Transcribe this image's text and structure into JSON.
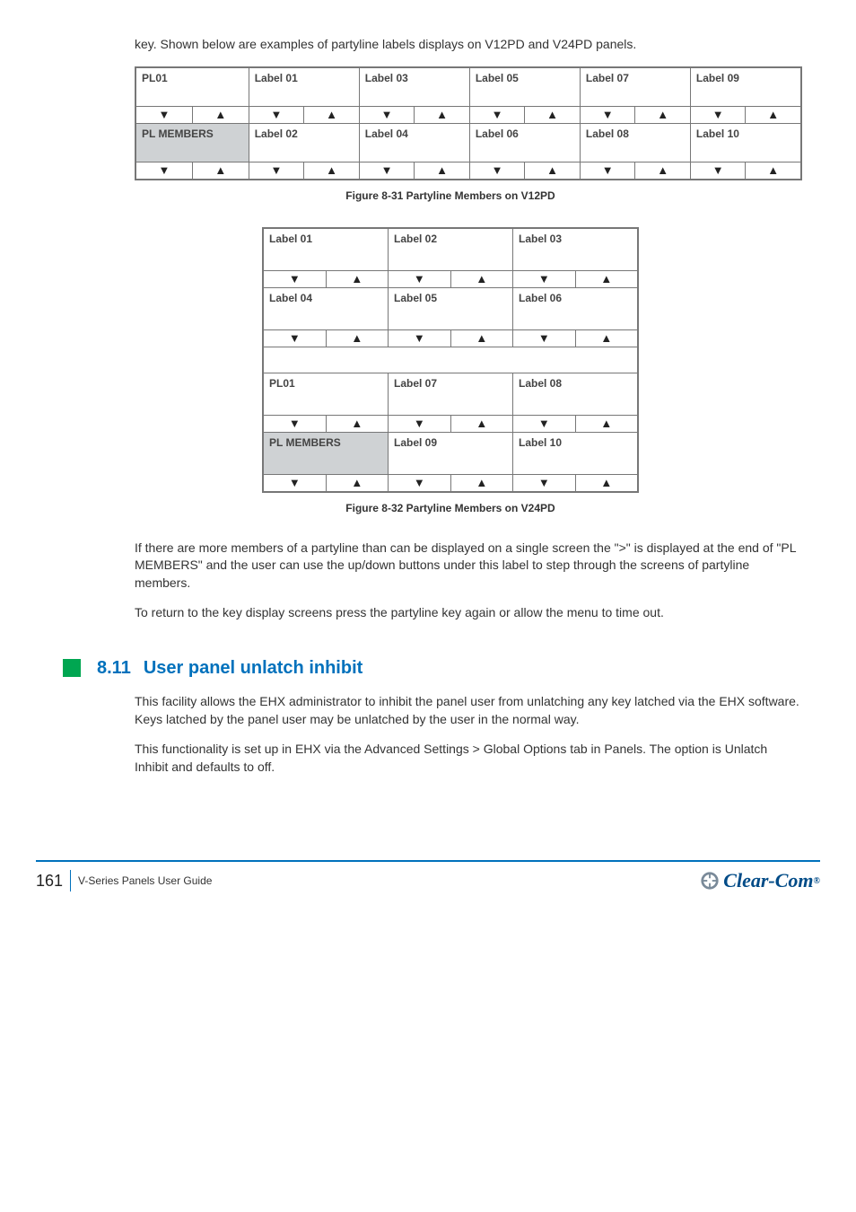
{
  "section": {
    "preface": "key. Shown below are examples of partyline labels displays on V12PD and V24PD panels."
  },
  "grid1": {
    "caption": "Figure 8-31 Partyline Members on V12PD",
    "cells": {
      "0_0": "PL01",
      "0_1": "Label 01",
      "0_2": "Label 03",
      "0_3": "Label 05",
      "0_4": "Label 07",
      "0_5": "Label 09",
      "2_0": "PL MEMBERS",
      "2_1": "Label 02",
      "2_2": "Label 04",
      "2_3": "Label 06",
      "2_4": "Label 08",
      "2_5": "Label 10"
    }
  },
  "grid2": {
    "caption": "Figure 8-32 Partyline Members on V24PD",
    "cells": {
      "0_0": "Label 01",
      "0_1": "Label 02",
      "0_2": "Label 03",
      "2_0": "Label 04",
      "2_1": "Label 05",
      "2_2": "Label 06",
      "5_0": "PL01",
      "5_1": "Label 07",
      "5_2": "Label 08",
      "7_0": "PL MEMBERS",
      "7_1": "Label 09",
      "7_2": "Label 10"
    }
  },
  "paragraphs": {
    "p1": "If there are more members of a partyline than can be displayed on a single screen the \">\" is displayed at the end of \"PL MEMBERS\" and the user can use the up/down buttons under this label to step through the screens of partyline members.",
    "p2": "To return to the key display screens press the partyline key again or allow the menu to time out."
  },
  "heading": {
    "num": "8.11",
    "title": "User panel unlatch inhibit"
  },
  "body": {
    "ui1": "This facility allows the EHX administrator to inhibit the panel user from unlatching any key latched via the EHX software. Keys latched by the panel user may be unlatched by the user in the normal way.",
    "ui2": "This functionality is set up in EHX via the Advanced Settings > Global Options tab in Panels. The option is Unlatch Inhibit and defaults to off."
  },
  "footer": {
    "page": "161",
    "docref": "V-Series Panels User Guide",
    "brand": "Clear-Com"
  }
}
